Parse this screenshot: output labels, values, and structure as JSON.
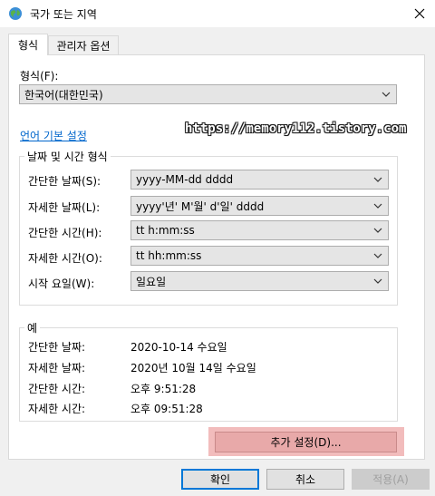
{
  "window": {
    "title": "국가 또는 지역"
  },
  "tabs": [
    {
      "label": "형식",
      "active": true
    },
    {
      "label": "관리자 옵션",
      "active": false
    }
  ],
  "format": {
    "label": "형식(F):",
    "value": "한국어(대한민국)"
  },
  "language_link": "언어 기본 설정",
  "watermark": "https://memory112.tistory.com",
  "date_time_group": {
    "title": "날짜 및 시간 형식",
    "rows": [
      {
        "label": "간단한 날짜(S):",
        "value": "yyyy-MM-dd dddd"
      },
      {
        "label": "자세한 날짜(L):",
        "value": "yyyy'년' M'월' d'일' dddd"
      },
      {
        "label": "간단한 시간(H):",
        "value": "tt h:mm:ss"
      },
      {
        "label": "자세한 시간(O):",
        "value": "tt hh:mm:ss"
      },
      {
        "label": "시작 요일(W):",
        "value": "일요일"
      }
    ]
  },
  "examples_group": {
    "title": "예",
    "rows": [
      {
        "label": "간단한 날짜:",
        "value": "2020-10-14 수요일"
      },
      {
        "label": "자세한 날짜:",
        "value": "2020년 10월 14일 수요일"
      },
      {
        "label": "간단한 시간:",
        "value": "오후 9:51:28"
      },
      {
        "label": "자세한 시간:",
        "value": "오후 09:51:28"
      }
    ]
  },
  "additional_settings": "추가 설정(D)...",
  "buttons": {
    "ok": "확인",
    "cancel": "취소",
    "apply": "적용(A)"
  },
  "colors": {
    "accent": "#0078d7",
    "link": "#0066cc",
    "highlight": "#f2bcbc"
  },
  "icons": {
    "app": "globe-icon",
    "close": "close-icon",
    "dropdown": "chevron-down-icon"
  }
}
